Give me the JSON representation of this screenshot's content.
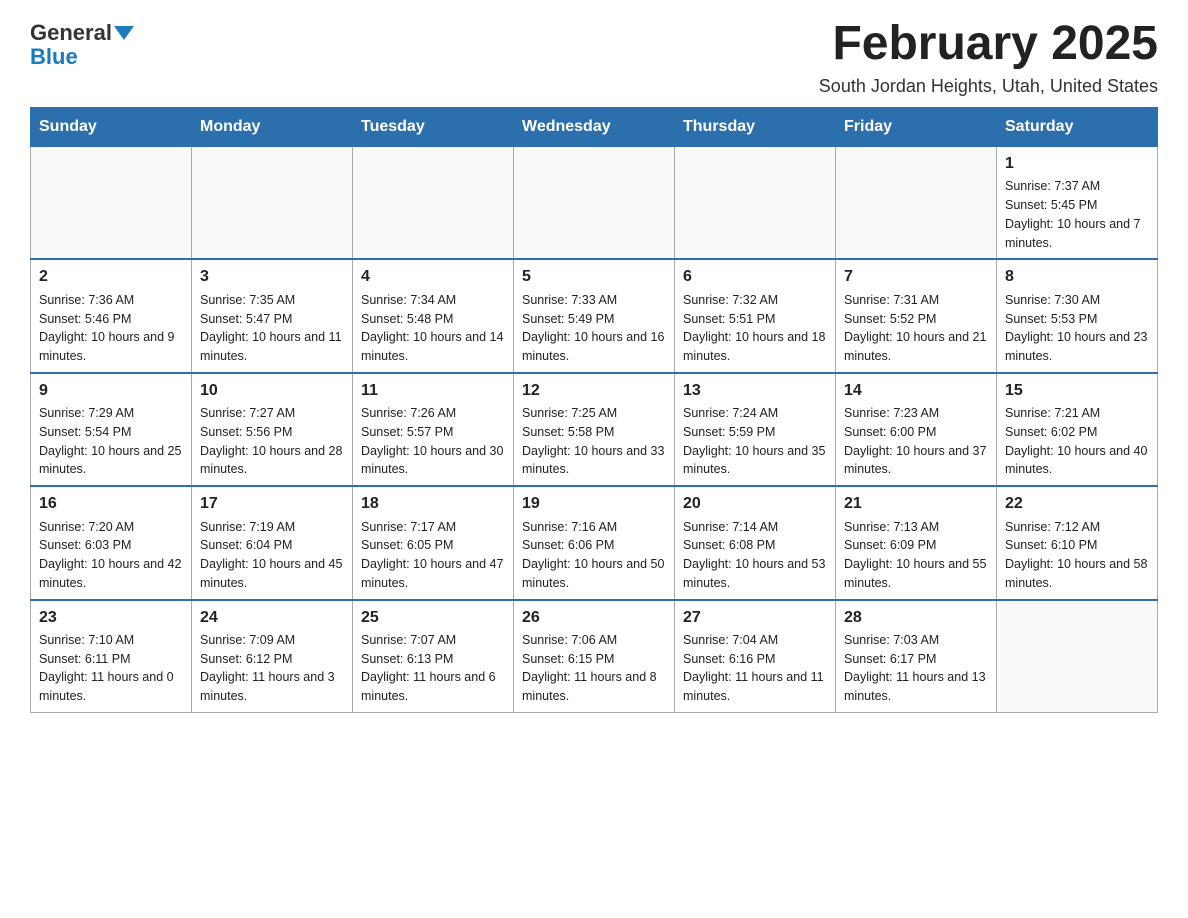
{
  "header": {
    "logo": {
      "general": "General",
      "blue": "Blue"
    },
    "title": "February 2025",
    "location": "South Jordan Heights, Utah, United States"
  },
  "days_of_week": [
    "Sunday",
    "Monday",
    "Tuesday",
    "Wednesday",
    "Thursday",
    "Friday",
    "Saturday"
  ],
  "weeks": [
    {
      "days": [
        {
          "num": "",
          "info": ""
        },
        {
          "num": "",
          "info": ""
        },
        {
          "num": "",
          "info": ""
        },
        {
          "num": "",
          "info": ""
        },
        {
          "num": "",
          "info": ""
        },
        {
          "num": "",
          "info": ""
        },
        {
          "num": "1",
          "info": "Sunrise: 7:37 AM\nSunset: 5:45 PM\nDaylight: 10 hours and 7 minutes."
        }
      ]
    },
    {
      "days": [
        {
          "num": "2",
          "info": "Sunrise: 7:36 AM\nSunset: 5:46 PM\nDaylight: 10 hours and 9 minutes."
        },
        {
          "num": "3",
          "info": "Sunrise: 7:35 AM\nSunset: 5:47 PM\nDaylight: 10 hours and 11 minutes."
        },
        {
          "num": "4",
          "info": "Sunrise: 7:34 AM\nSunset: 5:48 PM\nDaylight: 10 hours and 14 minutes."
        },
        {
          "num": "5",
          "info": "Sunrise: 7:33 AM\nSunset: 5:49 PM\nDaylight: 10 hours and 16 minutes."
        },
        {
          "num": "6",
          "info": "Sunrise: 7:32 AM\nSunset: 5:51 PM\nDaylight: 10 hours and 18 minutes."
        },
        {
          "num": "7",
          "info": "Sunrise: 7:31 AM\nSunset: 5:52 PM\nDaylight: 10 hours and 21 minutes."
        },
        {
          "num": "8",
          "info": "Sunrise: 7:30 AM\nSunset: 5:53 PM\nDaylight: 10 hours and 23 minutes."
        }
      ]
    },
    {
      "days": [
        {
          "num": "9",
          "info": "Sunrise: 7:29 AM\nSunset: 5:54 PM\nDaylight: 10 hours and 25 minutes."
        },
        {
          "num": "10",
          "info": "Sunrise: 7:27 AM\nSunset: 5:56 PM\nDaylight: 10 hours and 28 minutes."
        },
        {
          "num": "11",
          "info": "Sunrise: 7:26 AM\nSunset: 5:57 PM\nDaylight: 10 hours and 30 minutes."
        },
        {
          "num": "12",
          "info": "Sunrise: 7:25 AM\nSunset: 5:58 PM\nDaylight: 10 hours and 33 minutes."
        },
        {
          "num": "13",
          "info": "Sunrise: 7:24 AM\nSunset: 5:59 PM\nDaylight: 10 hours and 35 minutes."
        },
        {
          "num": "14",
          "info": "Sunrise: 7:23 AM\nSunset: 6:00 PM\nDaylight: 10 hours and 37 minutes."
        },
        {
          "num": "15",
          "info": "Sunrise: 7:21 AM\nSunset: 6:02 PM\nDaylight: 10 hours and 40 minutes."
        }
      ]
    },
    {
      "days": [
        {
          "num": "16",
          "info": "Sunrise: 7:20 AM\nSunset: 6:03 PM\nDaylight: 10 hours and 42 minutes."
        },
        {
          "num": "17",
          "info": "Sunrise: 7:19 AM\nSunset: 6:04 PM\nDaylight: 10 hours and 45 minutes."
        },
        {
          "num": "18",
          "info": "Sunrise: 7:17 AM\nSunset: 6:05 PM\nDaylight: 10 hours and 47 minutes."
        },
        {
          "num": "19",
          "info": "Sunrise: 7:16 AM\nSunset: 6:06 PM\nDaylight: 10 hours and 50 minutes."
        },
        {
          "num": "20",
          "info": "Sunrise: 7:14 AM\nSunset: 6:08 PM\nDaylight: 10 hours and 53 minutes."
        },
        {
          "num": "21",
          "info": "Sunrise: 7:13 AM\nSunset: 6:09 PM\nDaylight: 10 hours and 55 minutes."
        },
        {
          "num": "22",
          "info": "Sunrise: 7:12 AM\nSunset: 6:10 PM\nDaylight: 10 hours and 58 minutes."
        }
      ]
    },
    {
      "days": [
        {
          "num": "23",
          "info": "Sunrise: 7:10 AM\nSunset: 6:11 PM\nDaylight: 11 hours and 0 minutes."
        },
        {
          "num": "24",
          "info": "Sunrise: 7:09 AM\nSunset: 6:12 PM\nDaylight: 11 hours and 3 minutes."
        },
        {
          "num": "25",
          "info": "Sunrise: 7:07 AM\nSunset: 6:13 PM\nDaylight: 11 hours and 6 minutes."
        },
        {
          "num": "26",
          "info": "Sunrise: 7:06 AM\nSunset: 6:15 PM\nDaylight: 11 hours and 8 minutes."
        },
        {
          "num": "27",
          "info": "Sunrise: 7:04 AM\nSunset: 6:16 PM\nDaylight: 11 hours and 11 minutes."
        },
        {
          "num": "28",
          "info": "Sunrise: 7:03 AM\nSunset: 6:17 PM\nDaylight: 11 hours and 13 minutes."
        },
        {
          "num": "",
          "info": ""
        }
      ]
    }
  ]
}
